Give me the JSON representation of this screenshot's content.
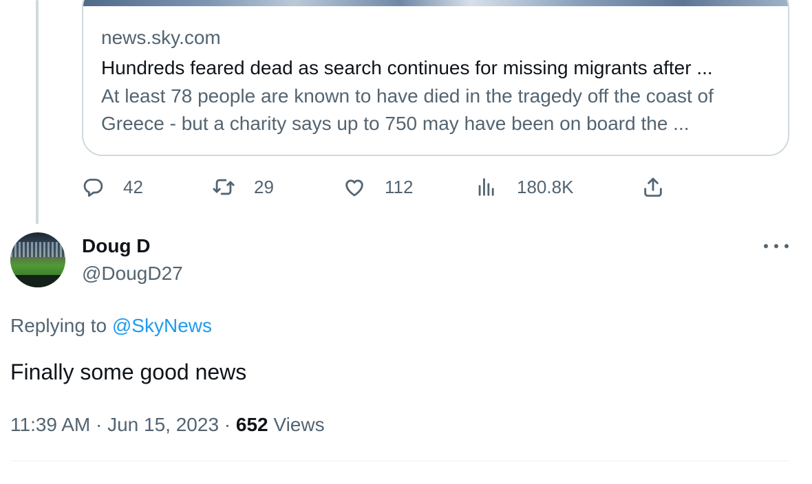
{
  "quoted_card": {
    "domain": "news.sky.com",
    "title": "Hundreds feared dead as search continues for missing migrants after ...",
    "description": "At least 78 people are known to have died in the tragedy off the coast of Greece - but a charity says up to 750 may have been on board the ..."
  },
  "actions": {
    "replies": "42",
    "retweets": "29",
    "likes": "112",
    "views": "180.8K"
  },
  "reply_tweet": {
    "display_name": "Doug D",
    "handle": "@DougD27",
    "replying_prefix": "Replying to",
    "replying_to": "@SkyNews",
    "text": "Finally some good news",
    "timestamp": "11:39 AM · Jun 15, 2023 · ",
    "views_count": "652",
    "views_label": " Views"
  },
  "colors": {
    "primary_text": "#0f1419",
    "secondary_text": "#536471",
    "link": "#1d9bf0",
    "border": "#cfd9de"
  },
  "icons": [
    "reply-icon",
    "retweet-icon",
    "like-icon",
    "views-icon",
    "share-icon",
    "more-icon"
  ]
}
